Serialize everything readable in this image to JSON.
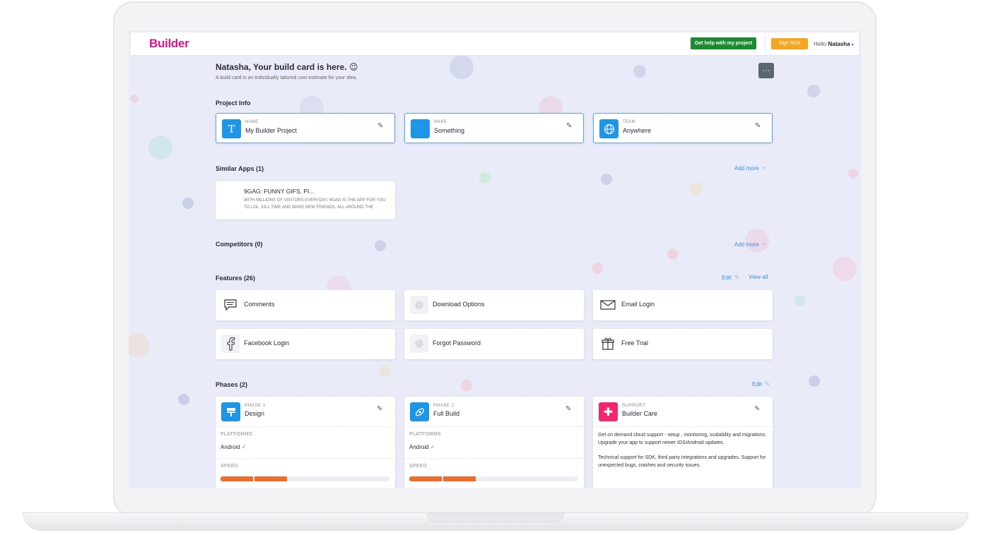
{
  "brand": {
    "logo": "Builder",
    "color": "#e0138c"
  },
  "header": {
    "help_button": "Get help with my project",
    "nda_button": "Sign NDA",
    "greeting": "Hello",
    "user_name": "Natasha"
  },
  "page": {
    "title": "Natasha, Your build card is here. 😉",
    "subtitle": "A build card is an individually tailored cost estimate for your idea.",
    "more_button": "···"
  },
  "project_info": {
    "heading": "Project Info",
    "items": [
      {
        "label": "NAME",
        "value": "My Builder Project",
        "icon": "text-T-icon"
      },
      {
        "label": "MAKE",
        "value": "Something",
        "icon": "blank-square-icon"
      },
      {
        "label": "TEAM",
        "value": "Anywhere",
        "icon": "globe-icon"
      }
    ]
  },
  "similar_apps": {
    "heading": "Similar Apps (1)",
    "add_more": "Add more",
    "items": [
      {
        "title": "9GAG: FUNNY GIFS, PI...",
        "description": "WITH MILLIONS OF VISITORS EVERYDAY, 9GAG IS THE APP FOR YOU TO LOL, KILL TIME AND MAKE NEW FRIENDS. ALL AROUND THE WORLD"
      }
    ]
  },
  "competitors": {
    "heading": "Competitors (0)",
    "add_more": "Add more"
  },
  "features": {
    "heading": "Features (26)",
    "edit": "Edit",
    "view_all": "View all",
    "items": [
      {
        "label": "Comments",
        "icon": "comment-icon"
      },
      {
        "label": "Download Options",
        "icon": "gear-icon"
      },
      {
        "label": "Email Login",
        "icon": "envelope-icon"
      },
      {
        "label": "Facebook Login",
        "icon": "facebook-icon"
      },
      {
        "label": "Forgot Password",
        "icon": "gear-icon"
      },
      {
        "label": "Free Trial",
        "icon": "gift-icon"
      }
    ]
  },
  "phases": {
    "heading": "Phases (2)",
    "edit": "Edit",
    "items": [
      {
        "label": "PHASE 1",
        "name": "Design",
        "icon": "design-icon",
        "platforms_label": "PLATFORMS",
        "platform": "Android",
        "speed_label": "SPEED",
        "speed_level": 0.4
      },
      {
        "label": "PHASE 2",
        "name": "Full Build",
        "icon": "rocket-icon",
        "platforms_label": "PLATFORMS",
        "platform": "Android",
        "speed_label": "SPEED",
        "speed_level": 0.4
      },
      {
        "label": "SUPPORT",
        "name": "Builder Care",
        "icon": "plus-icon",
        "text1": "Get on demand cloud support - setup , monitoring, scalability and migrations. Upgrade your app to support newer iOS/Android updates.",
        "text2": "Technical support for SDK, third party integrations and upgrades. Support for unexpected bugs, crashes and security issues."
      }
    ]
  },
  "colors": {
    "accent_blue": "#1e96e8",
    "help_green": "#1c8a2f",
    "nda_orange": "#f5a623",
    "speed_orange": "#f06a2a",
    "support_pink": "#f2256e"
  }
}
